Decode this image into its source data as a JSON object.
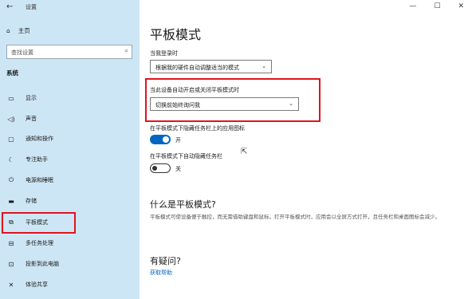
{
  "app": {
    "title": "设置"
  },
  "sidebar": {
    "home_label": "主页",
    "search_placeholder": "查找设置",
    "section_title": "系统",
    "items": [
      {
        "label": "显示",
        "icon": "monitor-icon"
      },
      {
        "label": "声音",
        "icon": "speaker-icon"
      },
      {
        "label": "通知和操作",
        "icon": "notification-icon"
      },
      {
        "label": "专注助手",
        "icon": "moon-icon"
      },
      {
        "label": "电源和睡眠",
        "icon": "power-icon"
      },
      {
        "label": "存储",
        "icon": "storage-icon"
      },
      {
        "label": "平板模式",
        "icon": "tablet-icon"
      },
      {
        "label": "多任务处理",
        "icon": "multitask-icon"
      },
      {
        "label": "投影到此电脑",
        "icon": "project-icon"
      },
      {
        "label": "体验共享",
        "icon": "share-icon"
      }
    ]
  },
  "main": {
    "title": "平板模式",
    "signin_label": "当我登录时",
    "signin_value": "根据我的硬件自动调整适当的模式",
    "autoswitch_label": "当此设备自动开启或关闭平板模式时",
    "autoswitch_value": "切换前始终询问我",
    "hide_icons_label": "在平板模式下隐藏任务栏上的应用图标",
    "hide_icons_state": "开",
    "hide_taskbar_label": "在平板模式下自动隐藏任务栏",
    "hide_taskbar_state": "关",
    "what_title": "什么是平板模式?",
    "what_desc": "平板模式可使设备便于触控，而无需借助键盘和鼠标。打开平板模式时，应用会以全屏方式打开，且任务栏和桌面图标会减少。",
    "question_title": "有疑问?",
    "help_link": "获取帮助"
  },
  "colors": {
    "sidebar_bg": "#cde6f5",
    "accent": "#0067c0",
    "highlight": "#e0141e"
  }
}
